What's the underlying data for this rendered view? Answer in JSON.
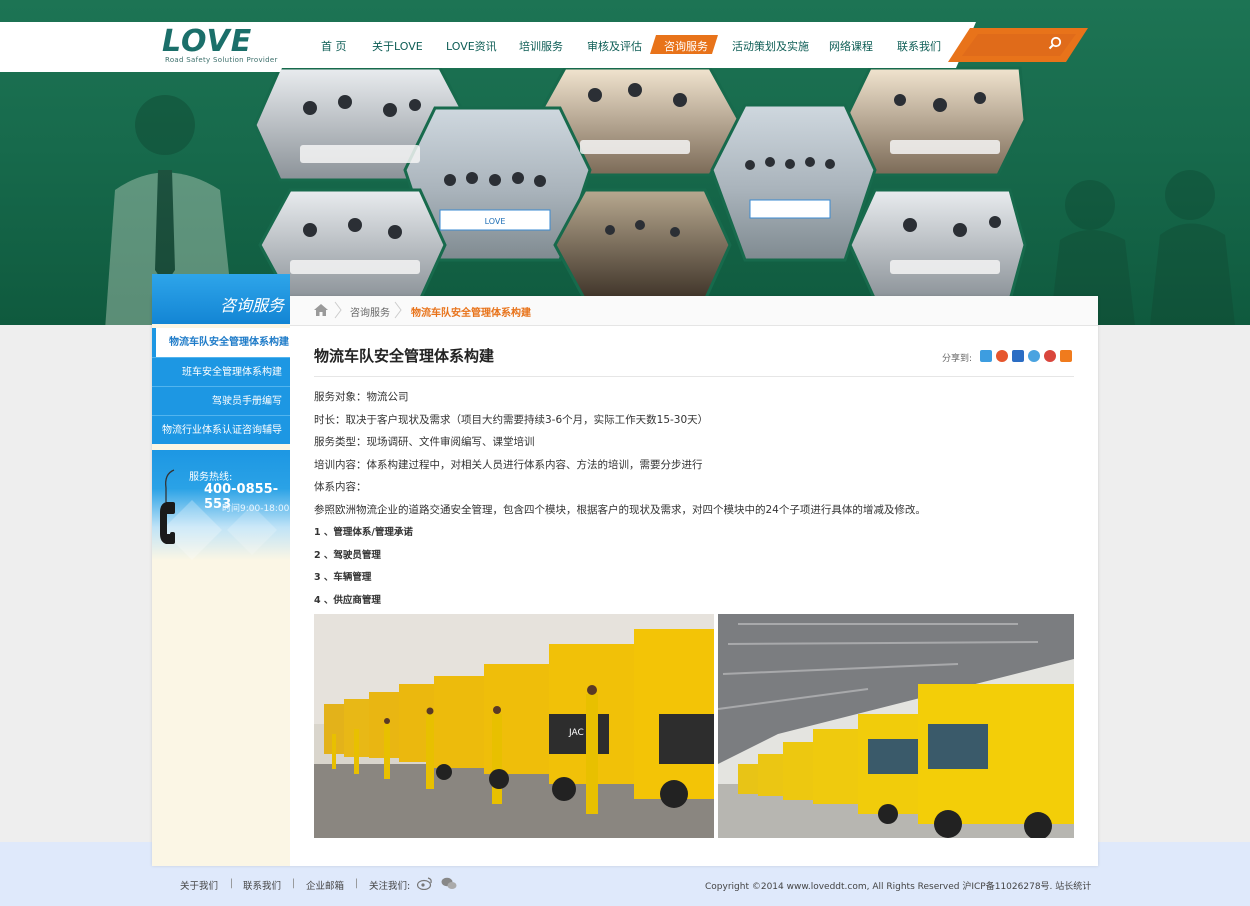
{
  "logo": {
    "text": "LOVE",
    "tagline": "Road Safety Solution Provider"
  },
  "nav": {
    "items": [
      {
        "label": "首 页"
      },
      {
        "label": "关于LOVE"
      },
      {
        "label": "LOVE资讯"
      },
      {
        "label": "培训服务"
      },
      {
        "label": "审核及评估"
      },
      {
        "label": "咨询服务",
        "active": true
      },
      {
        "label": "活动策划及实施"
      },
      {
        "label": "网络课程"
      },
      {
        "label": "联系我们"
      }
    ]
  },
  "sidebar": {
    "title": "咨询服务",
    "items": [
      {
        "label": "物流车队安全管理体系构建",
        "active": true
      },
      {
        "label": "班车安全管理体系构建"
      },
      {
        "label": "驾驶员手册编写"
      },
      {
        "label": "物流行业体系认证咨询辅导"
      }
    ],
    "hotline": {
      "label": "服务热线:",
      "number": "400-0855-553",
      "hours": "时间9:00-18:00"
    }
  },
  "breadcrumb": {
    "parent": "咨询服务",
    "current": "物流车队安全管理体系构建"
  },
  "article": {
    "title": "物流车队安全管理体系构建",
    "share_label": "分享到:",
    "lines": [
      "服务对象：物流公司",
      "时长：取决于客户现状及需求（项目大约需要持续3-6个月，实际工作天数15-30天）",
      "服务类型：现场调研、文件审阅编写、课堂培训",
      "培训内容：体系构建过程中，对相关人员进行体系内容、方法的培训，需要分步进行",
      "体系内容：",
      "参照欧洲物流企业的道路交通安全管理，包含四个模块，根据客户的现状及需求，对四个模块中的24个子项进行具体的增减及修改。"
    ],
    "modules": [
      "1 、管理体系/管理承诺",
      "2 、驾驶员管理",
      "3 、车辆管理",
      "4 、供应商管理"
    ]
  },
  "photos": {
    "banner_sign_1": "LOVE",
    "truck_text": "JAC"
  },
  "footer": {
    "links": [
      "关于我们",
      "联系我们",
      "企业邮箱",
      "关注我们:"
    ],
    "separator": "|",
    "copyright": "Copyright ©2014 www.loveddt.com, All Rights Reserved 沪ICP备11026278号.  站长统计"
  },
  "colors": {
    "green": "#176a4c",
    "orange": "#e8731a",
    "blue": "#1d97e3",
    "footer": "#dfe9fb"
  }
}
